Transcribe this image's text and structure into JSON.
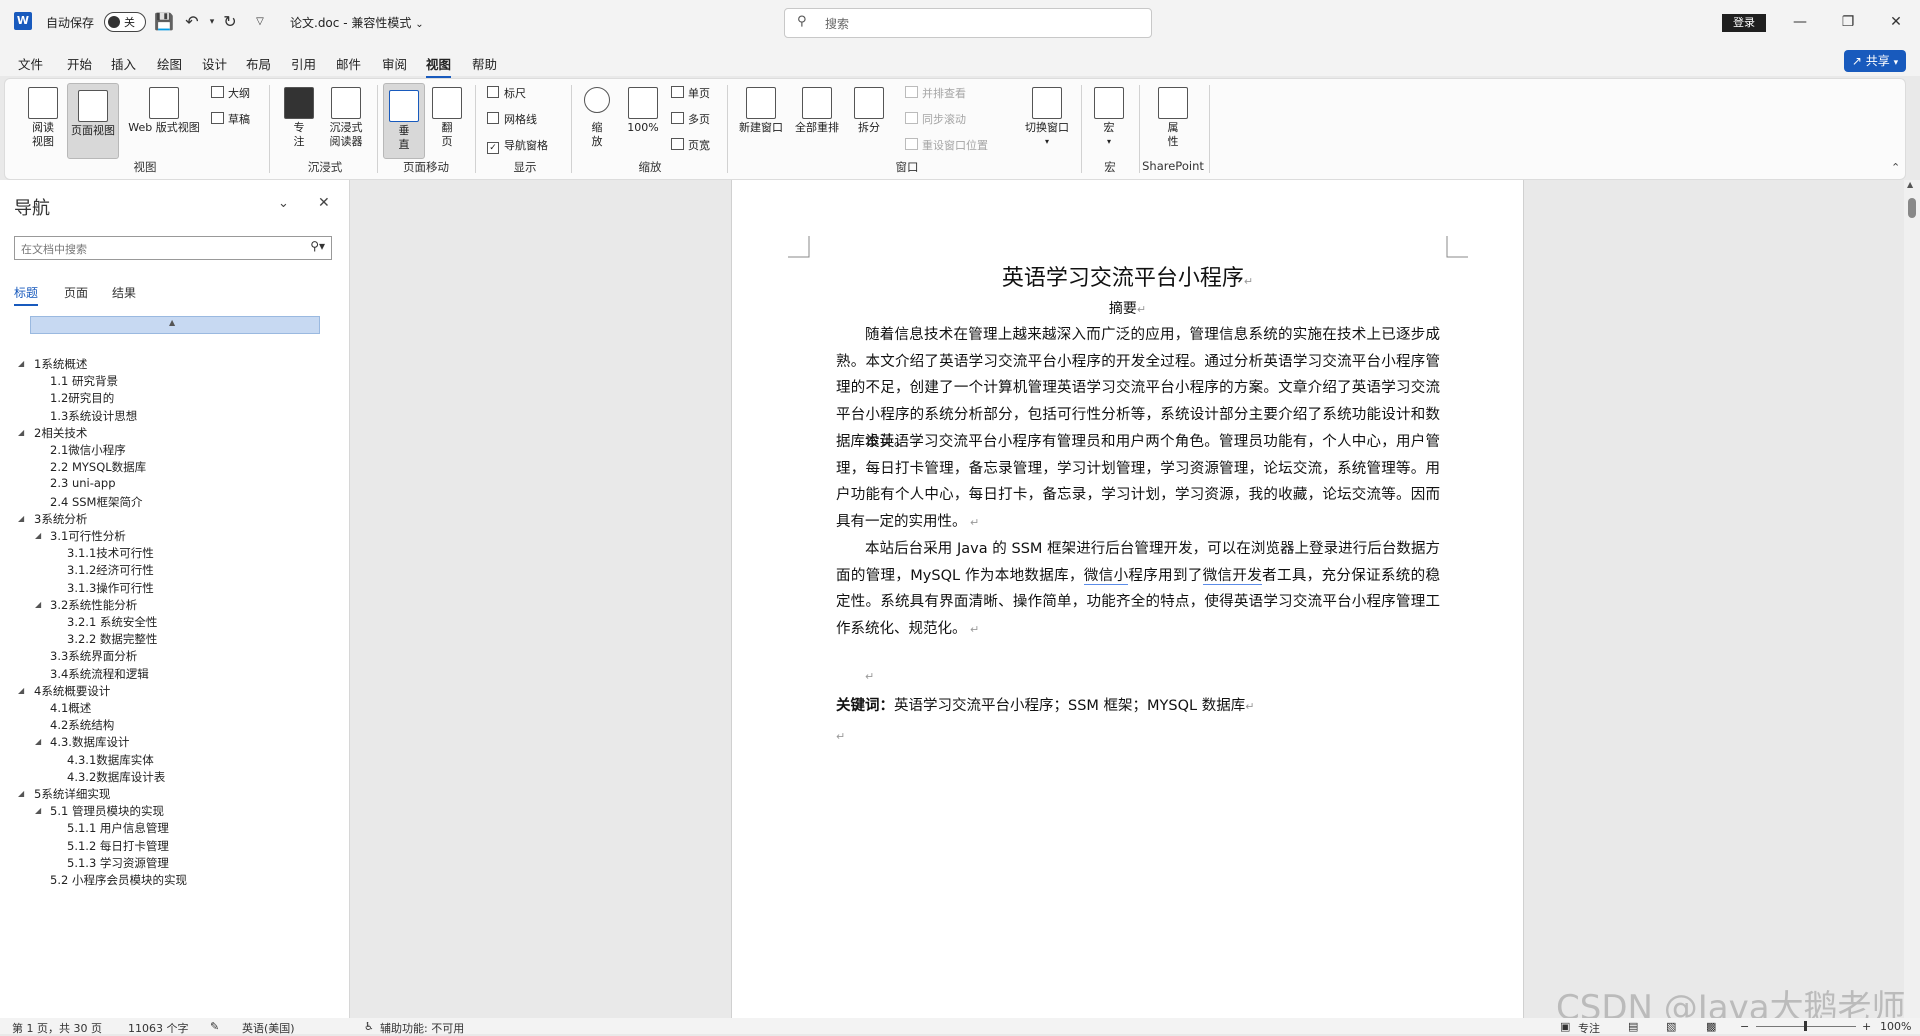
{
  "titlebar": {
    "autosave_label": "自动保存",
    "toggle_state": "关",
    "doc_name": "论文.doc",
    "mode": "兼容性模式",
    "search_placeholder": "搜索",
    "login_label": "登录"
  },
  "menu": {
    "tabs": [
      "文件",
      "开始",
      "插入",
      "绘图",
      "设计",
      "布局",
      "引用",
      "邮件",
      "审阅",
      "视图",
      "帮助"
    ],
    "active": "视图",
    "share_label": "共享"
  },
  "ribbon": {
    "views": {
      "read": "阅读\n视图",
      "print": "页面视图",
      "web": "Web 版式视图",
      "outline": "大纲",
      "draft": "草稿",
      "group": "视图"
    },
    "immersive": {
      "focus": "专\n注",
      "reader": "沉浸式\n阅读器",
      "group": "沉浸式"
    },
    "pagemove": {
      "vertical": "垂\n直",
      "side": "翻\n页",
      "group": "页面移动"
    },
    "show": {
      "ruler": "标尺",
      "gridlines": "网格线",
      "navpane": "导航窗格",
      "group": "显示"
    },
    "zoom": {
      "zoom": "缩\n放",
      "hundred": "100%",
      "onepage": "单页",
      "multipage": "多页",
      "pagewidth": "页宽",
      "group": "缩放"
    },
    "window": {
      "newwin": "新建窗口",
      "arrange": "全部重排",
      "split": "拆分",
      "sidebyside": "并排查看",
      "syncscroll": "同步滚动",
      "resetpos": "重设窗口位置",
      "switchwin": "切换窗口",
      "group": "窗口"
    },
    "macros": {
      "macro": "宏",
      "group": "宏"
    },
    "sharepoint": {
      "props": "属\n性",
      "group": "SharePoint"
    }
  },
  "nav": {
    "title": "导航",
    "search_placeholder": "在文档中搜索",
    "tabs": [
      "标题",
      "页面",
      "结果"
    ],
    "items": [
      {
        "label": "1系统概述",
        "level": 1
      },
      {
        "label": "1.1 研究背景",
        "level": 2
      },
      {
        "label": "1.2研究目的",
        "level": 2
      },
      {
        "label": "1.3系统设计思想",
        "level": 2
      },
      {
        "label": "2相关技术",
        "level": 1
      },
      {
        "label": "2.1微信小程序",
        "level": 2
      },
      {
        "label": "2.2 MYSQL数据库",
        "level": 2
      },
      {
        "label": "2.3 uni-app",
        "level": 2
      },
      {
        "label": "2.4 SSM框架简介",
        "level": 2
      },
      {
        "label": "3系统分析",
        "level": 1
      },
      {
        "label": "3.1可行性分析",
        "level": 2
      },
      {
        "label": "3.1.1技术可行性",
        "level": 3
      },
      {
        "label": "3.1.2经济可行性",
        "level": 3
      },
      {
        "label": "3.1.3操作可行性",
        "level": 3
      },
      {
        "label": "3.2系统性能分析",
        "level": 2
      },
      {
        "label": "3.2.1 系统安全性",
        "level": 3
      },
      {
        "label": "3.2.2 数据完整性",
        "level": 3
      },
      {
        "label": "3.3系统界面分析",
        "level": 2
      },
      {
        "label": "3.4系统流程和逻辑",
        "level": 2
      },
      {
        "label": "4系统概要设计",
        "level": 1
      },
      {
        "label": "4.1概述",
        "level": 2
      },
      {
        "label": "4.2系统结构",
        "level": 2
      },
      {
        "label": "4.3.数据库设计",
        "level": 2
      },
      {
        "label": "4.3.1数据库实体",
        "level": 3
      },
      {
        "label": "4.3.2数据库设计表",
        "level": 3
      },
      {
        "label": "5系统详细实现",
        "level": 1
      },
      {
        "label": "5.1 管理员模块的实现",
        "level": 2
      },
      {
        "label": "5.1.1 用户信息管理",
        "level": 3
      },
      {
        "label": "5.1.2 每日打卡管理",
        "level": 3
      },
      {
        "label": "5.1.3 学习资源管理",
        "level": 3
      },
      {
        "label": "5.2 小程序会员模块的实现",
        "level": 2
      }
    ]
  },
  "document": {
    "title": "英语学习交流平台小程序",
    "abstract_head": "摘要",
    "para1": "随着信息技术在管理上越来越深入而广泛的应用，管理信息系统的实施在技术上已逐步成熟。本文介绍了英语学习交流平台小程序的开发全过程。通过分析英语学习交流平台小程序管理的不足，创建了一个计算机管理英语学习交流平台小程序的方案。文章介绍了英语学习交流平台小程序的系统分析部分，包括可行性分析等，系统设计部分主要介绍了系统功能设计和数据库设计。",
    "para2": "本英语学习交流平台小程序有管理员和用户两个角色。管理员功能有，个人中心，用户管理，每日打卡管理，备忘录管理，学习计划管理，学习资源管理，论坛交流，系统管理等。用户功能有个人中心，每日打卡，备忘录，学习计划，学习资源，我的收藏，论坛交流等。因而具有一定的实用性。",
    "para3a": "本站后台采用 Java 的 SSM 框架进行后台管理开发，可以在浏览器上登录进行后台数据方面的管理，MySQL 作为本地数据库，",
    "para3_link1": "微信小",
    "para3b": "程序用到了",
    "para3_link2": "微信开发",
    "para3c": "者工具，充分保证系统的稳定性。系统具有界面清晰、操作简单，功能齐全的特点，使得英语学习交流平台小程序管理工作系统化、规范化。",
    "keywords_label": "关键词：",
    "keywords": "英语学习交流平台小程序；SSM 框架；MYSQL 数据库"
  },
  "status": {
    "page": "第 1 页，共 30 页",
    "words": "11063 个字",
    "lang": "英语(美国)",
    "accessibility": "辅助功能: 不可用",
    "focus": "专注",
    "zoom_pct": "100%"
  },
  "watermark": "CSDN @Java大鹅老师"
}
